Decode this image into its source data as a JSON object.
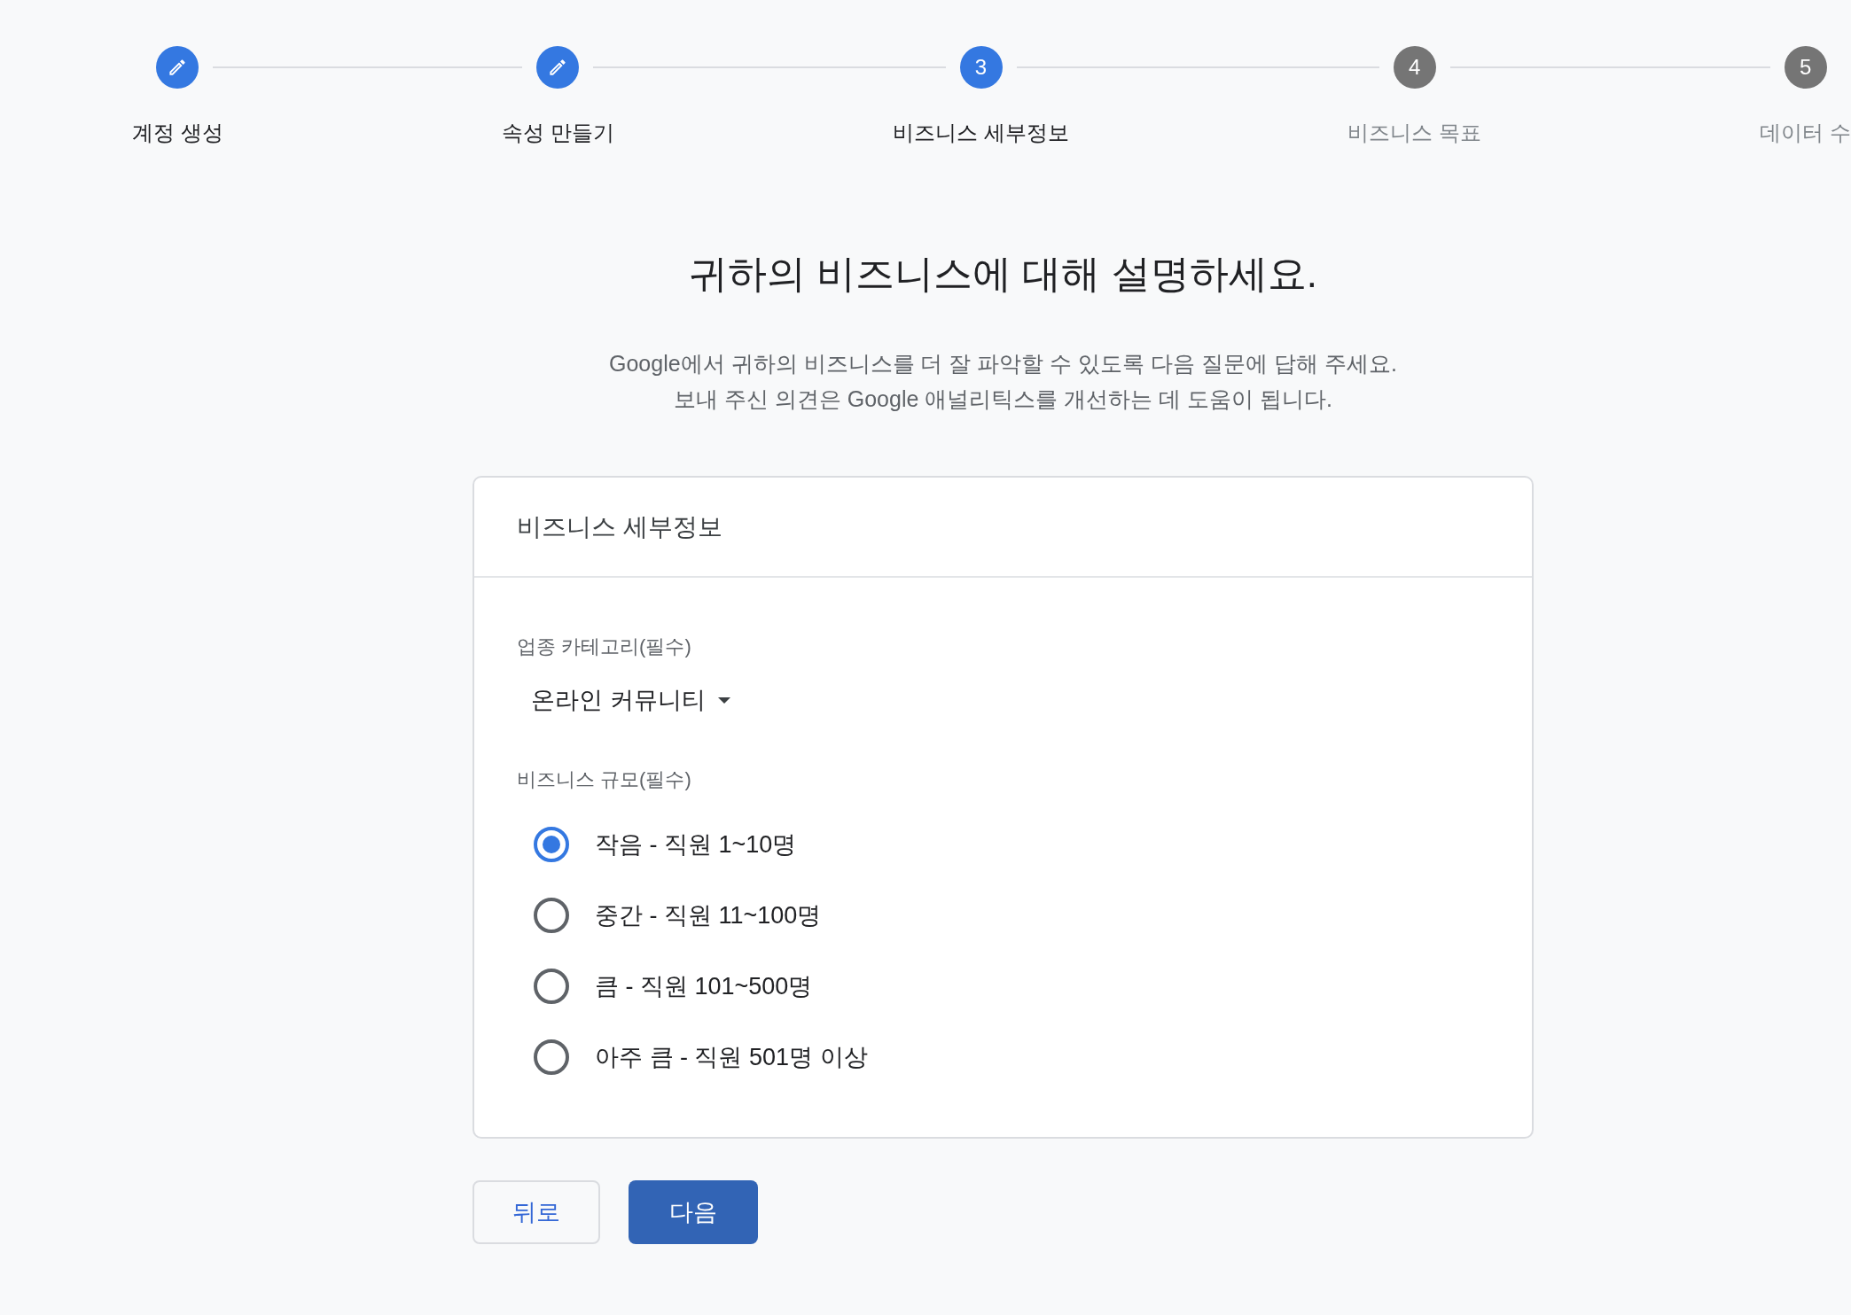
{
  "stepper": {
    "steps": [
      {
        "label": "계정 생성",
        "completed": true,
        "selected": false
      },
      {
        "label": "속성 만들기",
        "completed": true,
        "selected": false
      },
      {
        "label": "비즈니스 세부정보",
        "number": "3",
        "completed": false,
        "selected": true
      },
      {
        "label": "비즈니스 목표",
        "number": "4",
        "completed": false,
        "selected": false
      },
      {
        "label": "데이터 수",
        "number": "5",
        "completed": false,
        "selected": false
      }
    ]
  },
  "heading": "귀하의 비즈니스에 대해 설명하세요.",
  "intro": [
    "Google에서 귀하의 비즈니스를 더 잘 파악할 수 있도록 다음 질문에 답해 주세요.",
    "보내 주신 의견은 Google 애널리틱스를 개선하는 데 도움이 됩니다."
  ],
  "card": {
    "title": "비즈니스 세부정보",
    "category": {
      "label": "업종 카테고리(필수)",
      "value": "온라인 커뮤니티"
    },
    "size": {
      "label": "비즈니스 규모(필수)",
      "options": [
        {
          "label": "작음 - 직원 1~10명",
          "selected": true
        },
        {
          "label": "중간 - 직원 11~100명",
          "selected": false
        },
        {
          "label": "큼 - 직원 101~500명",
          "selected": false
        },
        {
          "label": "아주 큼 - 직원 501명 이상",
          "selected": false
        }
      ]
    }
  },
  "buttons": [
    {
      "label": "뒤로",
      "kind": "secondary"
    },
    {
      "label": "다음",
      "kind": "primary"
    }
  ]
}
